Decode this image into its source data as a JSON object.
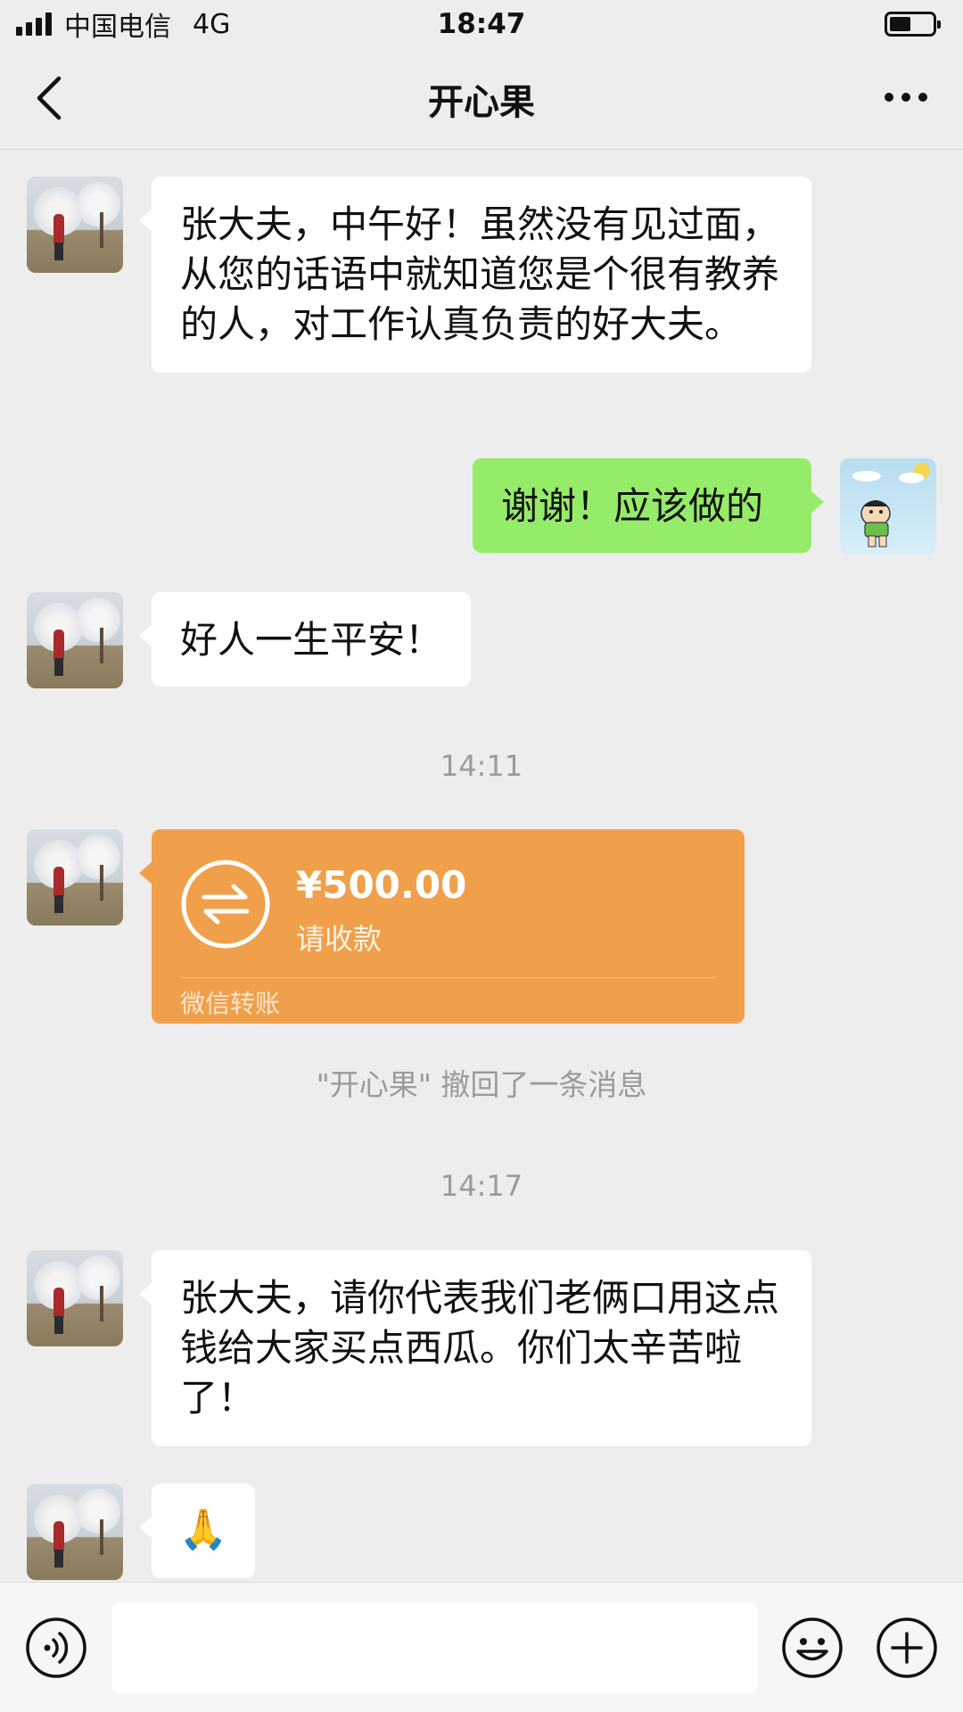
{
  "status_bar": {
    "carrier": "中国电信",
    "network": "4G",
    "time": "18:47"
  },
  "nav": {
    "title": "开心果",
    "back_icon": "chevron-left-icon",
    "more_icon": "more-dots-icon"
  },
  "messages": [
    {
      "side": "left",
      "type": "text",
      "text": "张大夫，中午好！虽然没有见过面，从您的话语中就知道您是个很有教养的人，对工作认真负责的好大夫。"
    },
    {
      "side": "right",
      "type": "text",
      "text": "谢谢！应该做的"
    },
    {
      "side": "left",
      "type": "text",
      "text": "好人一生平安！"
    }
  ],
  "timestamp_1": "14:11",
  "transfer": {
    "amount": "¥500.00",
    "status": "请收款",
    "footer": "微信转账",
    "icon": "transfer-arrows-icon"
  },
  "recall_notice": "\"开心果\" 撤回了一条消息",
  "timestamp_2": "14:17",
  "messages_after": [
    {
      "side": "left",
      "type": "text",
      "text": "张大夫，请你代表我们老俩口用这点钱给大家买点西瓜。你们太辛苦啦了！"
    },
    {
      "side": "left",
      "type": "emoji",
      "text": "🙏"
    }
  ],
  "input_bar": {
    "voice_icon": "voice-icon",
    "input_value": "",
    "emoji_icon": "emoji-icon",
    "plus_icon": "plus-icon"
  },
  "colors": {
    "background": "#ededed",
    "green_bubble": "#95ec69",
    "transfer_orange": "#f0a04b"
  }
}
